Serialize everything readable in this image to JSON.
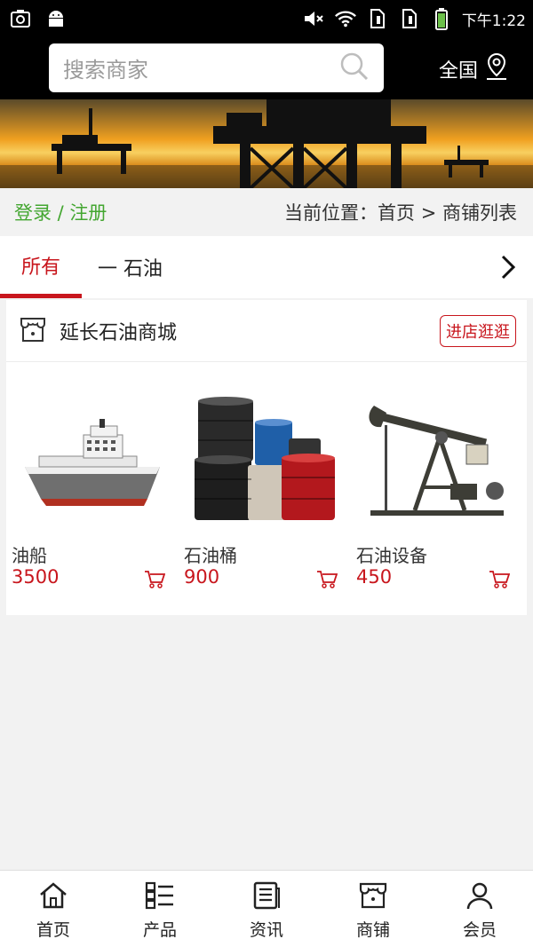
{
  "statusbar": {
    "left_icons": [
      "camera-icon",
      "android-icon"
    ],
    "right_icons": [
      "mute-icon",
      "wifi-icon",
      "sim1-icon",
      "sim2-icon",
      "battery-icon"
    ],
    "time": "下午1:22"
  },
  "header": {
    "search_placeholder": "搜索商家",
    "region": "全国"
  },
  "location_bar": {
    "login_register": "登录 / 注册",
    "breadcrumb": "当前位置：首页 > 商铺列表"
  },
  "tabs": {
    "active": "所有",
    "items": [
      "一 石油"
    ]
  },
  "shop": {
    "name": "延长石油商城",
    "enter_button": "进店逛逛",
    "products": [
      {
        "name": "油船",
        "price": "3500"
      },
      {
        "name": "石油桶",
        "price": "900"
      },
      {
        "name": "石油设备",
        "price": "450"
      }
    ]
  },
  "bottom_nav": [
    {
      "label": "首页",
      "icon": "home-icon"
    },
    {
      "label": "产品",
      "icon": "product-list-icon"
    },
    {
      "label": "资讯",
      "icon": "news-icon"
    },
    {
      "label": "商铺",
      "icon": "shop-icon"
    },
    {
      "label": "会员",
      "icon": "member-icon"
    }
  ],
  "colors": {
    "accent_red": "#c8161d",
    "login_green": "#43a630",
    "header_bg": "#000000"
  }
}
